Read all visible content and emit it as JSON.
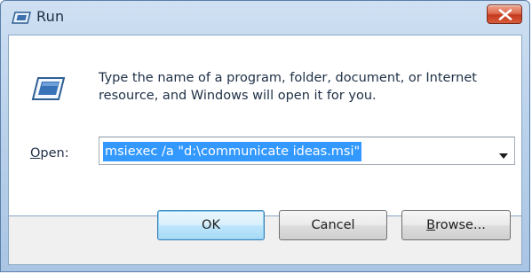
{
  "window": {
    "title": "Run",
    "title_icon": "run-icon",
    "close_icon": "close-icon"
  },
  "dialog": {
    "program_icon": "run-program-icon",
    "description": "Type the name of a program, folder, document, or Internet resource, and Windows will open it for you.",
    "open_label_mnemonic": "O",
    "open_label_rest": "pen:",
    "open_value": "msiexec /a \"d:\\communicate ideas.msi\"",
    "dropdown_icon": "chevron-down-icon"
  },
  "buttons": {
    "ok_label": "OK",
    "cancel_label": "Cancel",
    "browse_mnemonic": "B",
    "browse_rest": "rowse..."
  },
  "colors": {
    "titlebar": "#bcd3ec",
    "selection": "#3399ff",
    "close_button": "#c5391e",
    "default_button_border": "#3c7fb1"
  }
}
